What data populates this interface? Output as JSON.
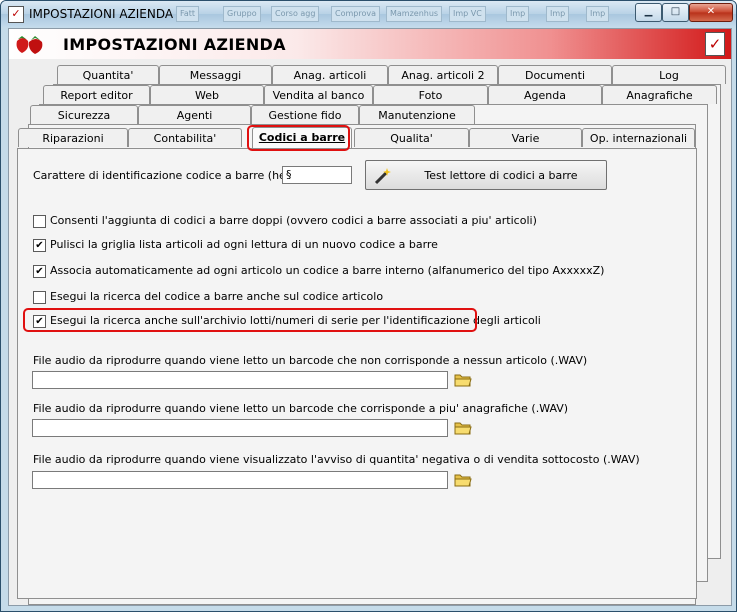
{
  "window": {
    "title": "IMPOSTAZIONI AZIENDA",
    "header_title": "IMPOSTAZIONI AZIENDA",
    "ghost_taskbar": [
      "Fatt",
      "Gruppo",
      "Corso agg",
      "Comprova",
      "Mamzenhus",
      "Imp VC",
      "Imp",
      "Imp",
      "Imp"
    ]
  },
  "tabs": {
    "row1": [
      "Quantita'",
      "Messaggi",
      "Anag. articoli",
      "Anag. articoli 2",
      "Documenti",
      "Log"
    ],
    "row2": [
      "Report editor",
      "Web",
      "Vendita al banco",
      "Foto",
      "Agenda",
      "Anagrafiche"
    ],
    "row3": [
      "Sicurezza",
      "Agenti",
      "Gestione fido",
      "Manutenzione"
    ],
    "row4": [
      "Riparazioni",
      "Contabilita'",
      "Codici a barre",
      "Qualita'",
      "Varie",
      "Op. internazionali"
    ]
  },
  "form": {
    "header_label": "Carattere di identificazione codice a barre (header) :",
    "header_value": "§",
    "test_button": "Test lettore di codici a barre",
    "options": [
      {
        "label": "Consenti l'aggiunta di codici a barre doppi (ovvero codici a barre associati a piu' articoli)",
        "checked": false
      },
      {
        "label": "Pulisci la griglia lista articoli ad ogni lettura di un nuovo codice a barre",
        "checked": true
      },
      {
        "label": "Associa automaticamente ad ogni articolo un codice a barre interno (alfanumerico del tipo AxxxxxZ)",
        "checked": true
      },
      {
        "label": "Esegui la ricerca del codice a barre anche sul codice articolo",
        "checked": false
      },
      {
        "label": "Esegui la ricerca anche sull'archivio lotti/numeri di serie per l'identificazione degli articoli",
        "checked": true
      }
    ],
    "audio": [
      {
        "label": "File audio da riprodurre quando viene letto un barcode che non corrisponde a nessun articolo (.WAV)",
        "value": ""
      },
      {
        "label": "File audio da riprodurre quando viene letto un barcode che corrisponde a piu' anagrafiche (.WAV)",
        "value": ""
      },
      {
        "label": "File audio da riprodurre quando viene visualizzato l'avviso di quantita' negativa o di vendita sottocosto (.WAV)",
        "value": ""
      }
    ]
  },
  "colors": {
    "highlight": "#e01010",
    "header_red": "#d21818"
  }
}
